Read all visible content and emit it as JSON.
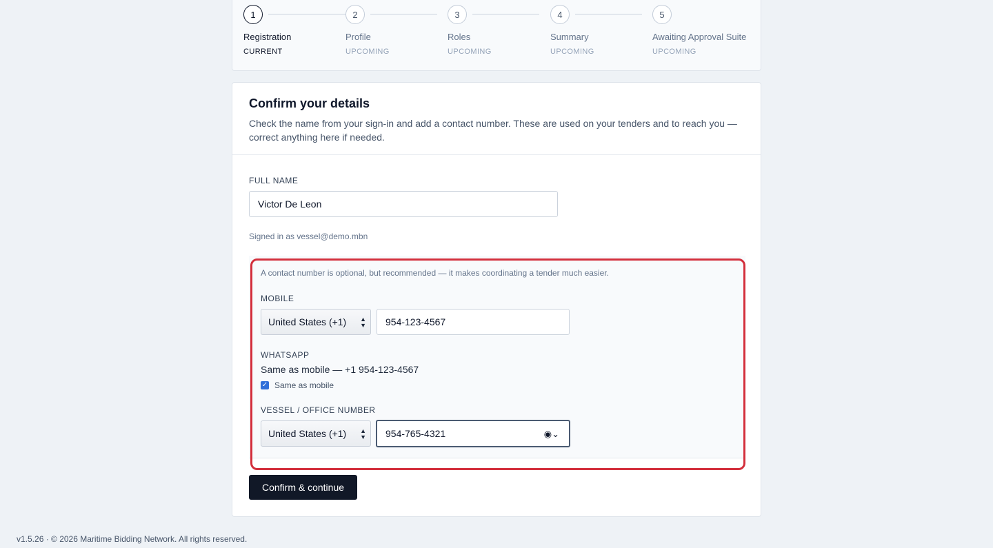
{
  "steps": [
    {
      "number": "1",
      "title": "Registration",
      "status": "CURRENT"
    },
    {
      "number": "2",
      "title": "Profile",
      "status": "UPCOMING"
    },
    {
      "number": "3",
      "title": "Roles",
      "status": "UPCOMING"
    },
    {
      "number": "4",
      "title": "Summary",
      "status": "UPCOMING"
    },
    {
      "number": "5",
      "title": "Awaiting Approval Suite",
      "status": "UPCOMING"
    }
  ],
  "card": {
    "title": "Confirm your details",
    "description": "Check the name from your sign-in and add a contact number. These are used on your tenders and to reach you — correct anything here if needed."
  },
  "full_name": {
    "label": "FULL NAME",
    "value": "Victor De Leon"
  },
  "signed_in_text": "Signed in as vessel@demo.mbn",
  "contact": {
    "hint": "A contact number is optional, but recommended — it makes coordinating a tender much easier.",
    "mobile": {
      "label": "MOBILE",
      "country": "United States (+1)",
      "number": "954-123-4567"
    },
    "whatsapp": {
      "label": "WHATSAPP",
      "value": "Same as mobile — +1 954-123-4567",
      "checkbox_label": "Same as mobile",
      "checked": true
    },
    "vessel": {
      "label": "VESSEL / OFFICE NUMBER",
      "country": "United States (+1)",
      "number": "954-765-4321"
    }
  },
  "confirm_label": "Confirm & continue",
  "footer": "v1.5.26 · © 2026 Maritime Bidding Network. All rights reserved.",
  "colors": {
    "primary_button": "#111827",
    "highlight": "#d32f3c",
    "checkbox": "#2f6fd9"
  }
}
